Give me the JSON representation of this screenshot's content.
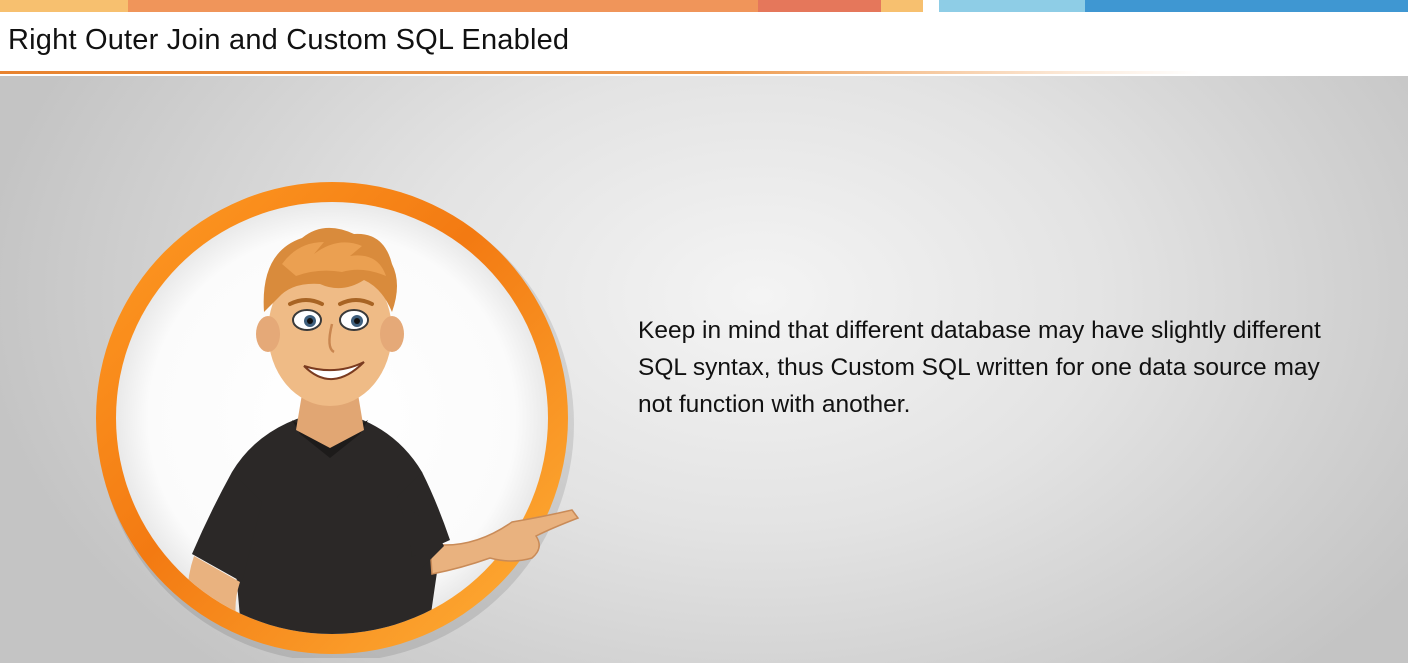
{
  "slide": {
    "title": "Right Outer Join and Custom SQL Enabled",
    "body_text": "Keep in mind that different database may have slightly different SQL syntax, thus Custom SQL written for one data source may not function with another."
  },
  "top_strip": {
    "colors": [
      "#f7c06f",
      "#f0955a",
      "#e5775b",
      "#f7c06f",
      "#ffffff",
      "#8ecde6",
      "#3f97d2"
    ]
  },
  "icons": {
    "character": "presenter-character-illustration"
  }
}
